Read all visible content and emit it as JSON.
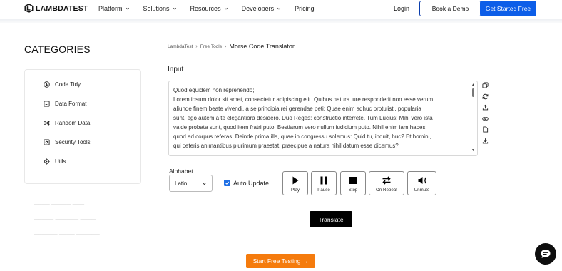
{
  "header": {
    "logo_text": "LAMBDATEST",
    "nav": [
      "Platform",
      "Solutions",
      "Resources",
      "Developers",
      "Pricing"
    ],
    "login": "Login",
    "book_demo": "Book a Demo",
    "get_started": "Get Started Free"
  },
  "sidebar": {
    "title": "CATEGORIES",
    "items": [
      {
        "label": "Code Tidy",
        "icon": "code-tidy-icon"
      },
      {
        "label": "Data Format",
        "icon": "data-format-icon"
      },
      {
        "label": "Random Data",
        "icon": "shuffle-icon"
      },
      {
        "label": "Security Tools",
        "icon": "security-icon"
      },
      {
        "label": "Utils",
        "icon": "utils-icon"
      }
    ]
  },
  "breadcrumb": [
    "LambdaTest",
    "Free Tools",
    "Morse Code Translator"
  ],
  "input": {
    "label": "Input",
    "lines": [
      "Quod equidem non reprehendo;",
      "Lorem ipsum dolor sit amet, consectetur adipiscing elit. Quibus natura iure responderit non esse verum",
      "aliunde finem beate vivendi, a se principia rei gerendae peti; Quae enim adhuc protulisti, popularia",
      "sunt, ego autem a te elegantiora desidero. Duo Reges: constructio interrete. Tum Lucius: Mihi vero ista",
      "valde probata sunt, quod item fratri puto. Bestiarum vero nullum iudicium puto. Nihil enim iam habes,",
      "quod ad corpus referas; Deinde prima illa, quae in congressu solemus: Quid tu, inquit, huc? Et homini,",
      "qui ceteris animantibus plurimum praestat, praecipue a natura nihil datum esse dicemus?"
    ]
  },
  "alphabet": {
    "label": "Alphabet",
    "selected": "Latin"
  },
  "auto_update": {
    "label": "Auto Update",
    "checked": true
  },
  "controls": {
    "play": "Play",
    "pause": "Pause",
    "stop": "Stop",
    "repeat": "On Repeat",
    "unmute": "Unmute"
  },
  "translate": "Translate",
  "start_free": "Start Free Testing →",
  "colors": {
    "primary": "#0d5ee8",
    "orange": "#f57b0d",
    "dark": "#000000"
  }
}
